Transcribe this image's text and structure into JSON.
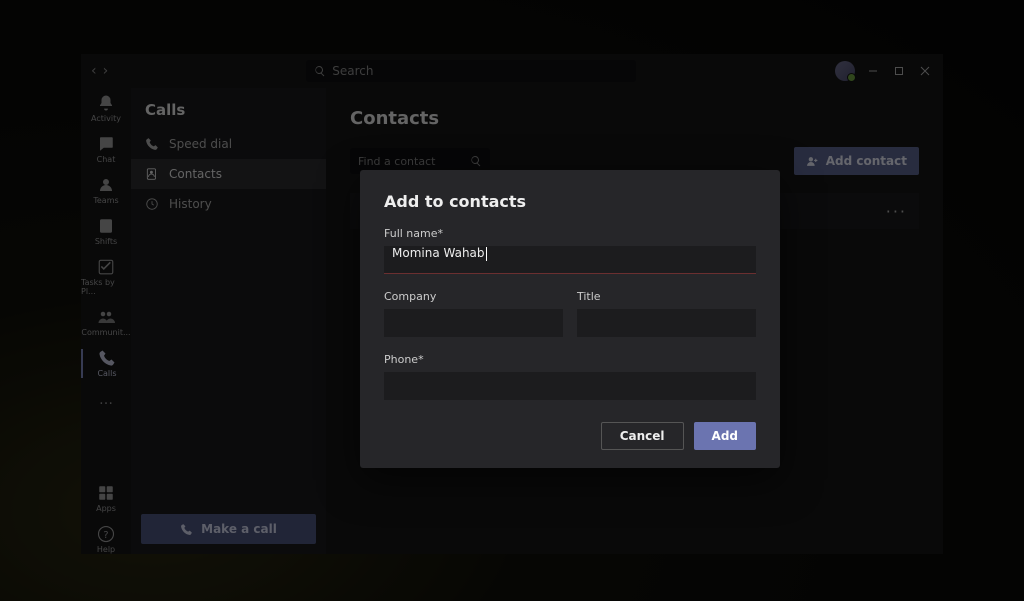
{
  "search": {
    "placeholder": "Search"
  },
  "rail": {
    "activity": "Activity",
    "chat": "Chat",
    "teams": "Teams",
    "shifts": "Shifts",
    "tasks": "Tasks by Pl...",
    "communities": "Communit...",
    "calls": "Calls",
    "apps": "Apps",
    "help": "Help"
  },
  "sub": {
    "title": "Calls",
    "speed_dial": "Speed dial",
    "contacts": "Contacts",
    "history": "History",
    "make_call": "Make a call"
  },
  "main": {
    "title": "Contacts",
    "find_placeholder": "Find a contact",
    "add_contact": "Add contact"
  },
  "modal": {
    "title": "Add to contacts",
    "full_name_label": "Full name*",
    "full_name_value": "Momina Wahab",
    "company_label": "Company",
    "company_value": "",
    "title_label": "Title",
    "title_value": "",
    "phone_label": "Phone*",
    "phone_value": "",
    "cancel": "Cancel",
    "add": "Add"
  }
}
